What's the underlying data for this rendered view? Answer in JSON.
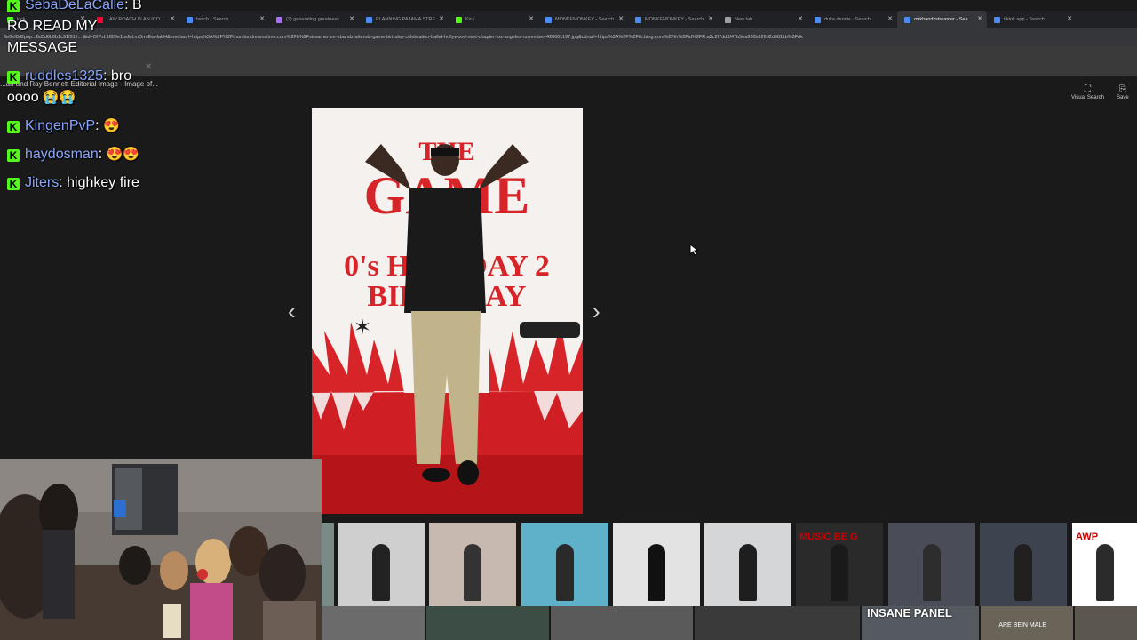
{
  "browser": {
    "tabs": [
      {
        "label": "kick",
        "active": false,
        "color": "#53fc18"
      },
      {
        "label": "LAW ROACH IS AN ICONIC",
        "active": false,
        "color": "#ff0033"
      },
      {
        "label": "twitch - Search",
        "active": false,
        "color": "#4a8bf5"
      },
      {
        "label": "(2) generating greatness",
        "active": false,
        "color": "#a970ff"
      },
      {
        "label": "PLANNING PAJAMA STRE",
        "active": false,
        "color": "#4a8bf5"
      },
      {
        "label": "Kick",
        "active": false,
        "color": "#53fc18"
      },
      {
        "label": "MONKEMONKEY - Search",
        "active": false,
        "color": "#4a8bf5"
      },
      {
        "label": "MONKEMONKEY - Search",
        "active": false,
        "color": "#4a8bf5"
      },
      {
        "label": "New tab",
        "active": false,
        "color": "#9aa0a6"
      },
      {
        "label": "duke dennis - Search",
        "active": false,
        "color": "#4a8bf5"
      },
      {
        "label": "mrkbandzstreamer - Sea",
        "active": true,
        "color": "#4a8bf5"
      },
      {
        "label": "tiktok app - Search",
        "active": false,
        "color": "#4a8bf5"
      }
    ],
    "address": "8e0ef8d2pop...8d5d6b0b1c91f91fi... &id=OIP.d:1f8f0e1psMLmOmIEwHaLH&mediaurl=https%3A%2F%2Fthumbs.dreamstime.com%2Fb%2Fstreamer-mr-kbandz-attends-game-birthday-celebration-ballet-hollywood-next-chapter-los-angeles-november-420681197.jpg&cdnurl=https%3A%2F%2Fth.bing.com%2Fth%2Fid%2FR.a2c2f7dd3f47b5ea930b926d2d9811b%3Frik"
  },
  "viewer": {
    "caption": "...an and Ray Bennett Editorial Image - Image of...",
    "visual_search_label": "Visual Search",
    "save_label": "Save",
    "prev_glyph": "‹",
    "next_glyph": "›",
    "backdrop": {
      "line1": "THE",
      "line2": "GAME",
      "line3": "0's HOLIDAY 2",
      "line4": "BIRTHDAY"
    }
  },
  "chat": {
    "messages": [
      {
        "user": "SebaDeLaCalle",
        "text": "B RO READ MY MESSAGE"
      },
      {
        "user": "ruddles1325",
        "text": "bro oooo",
        "emoji": "😭😭"
      },
      {
        "user": "KingenPvP",
        "text": "",
        "emoji": "😍"
      },
      {
        "user": "haydosman",
        "text": "",
        "emoji": "😍😍"
      },
      {
        "user": "Jiters",
        "text": "highkey fire"
      }
    ],
    "badge_letter": "K",
    "badge_color": "#53fc18"
  },
  "thumbnails": {
    "top": [
      {
        "label": "",
        "bg": "#7a8a86"
      },
      {
        "label": "",
        "bg": "#cfcfcf"
      },
      {
        "label": "",
        "bg": "#c8b9b0"
      },
      {
        "label": "",
        "bg": "#5fb0c9"
      },
      {
        "label": "",
        "bg": "#e3e3e3"
      },
      {
        "label": "",
        "bg": "#d4d6d8"
      },
      {
        "label": "MUSIC BE G",
        "bg": "#2a2a2a"
      },
      {
        "label": "",
        "bg": "#4a4d57"
      },
      {
        "label": "",
        "bg": "#3e4350"
      },
      {
        "label": "AWP",
        "bg": "#ffffff"
      }
    ],
    "bottom": [
      {
        "label": "",
        "bg": "#6b6b6b"
      },
      {
        "label": "",
        "bg": "#3c4d45"
      },
      {
        "label": "",
        "bg": "#5a5a5a"
      },
      {
        "label": "",
        "bg": "#3a3a3a"
      },
      {
        "label": "INSANE PANEL",
        "bg": "#555a60"
      },
      {
        "label": "",
        "bg": "#6a6458",
        "small": "ARE BEIN MALE"
      },
      {
        "label": "",
        "bg": "#5b574e"
      }
    ]
  }
}
